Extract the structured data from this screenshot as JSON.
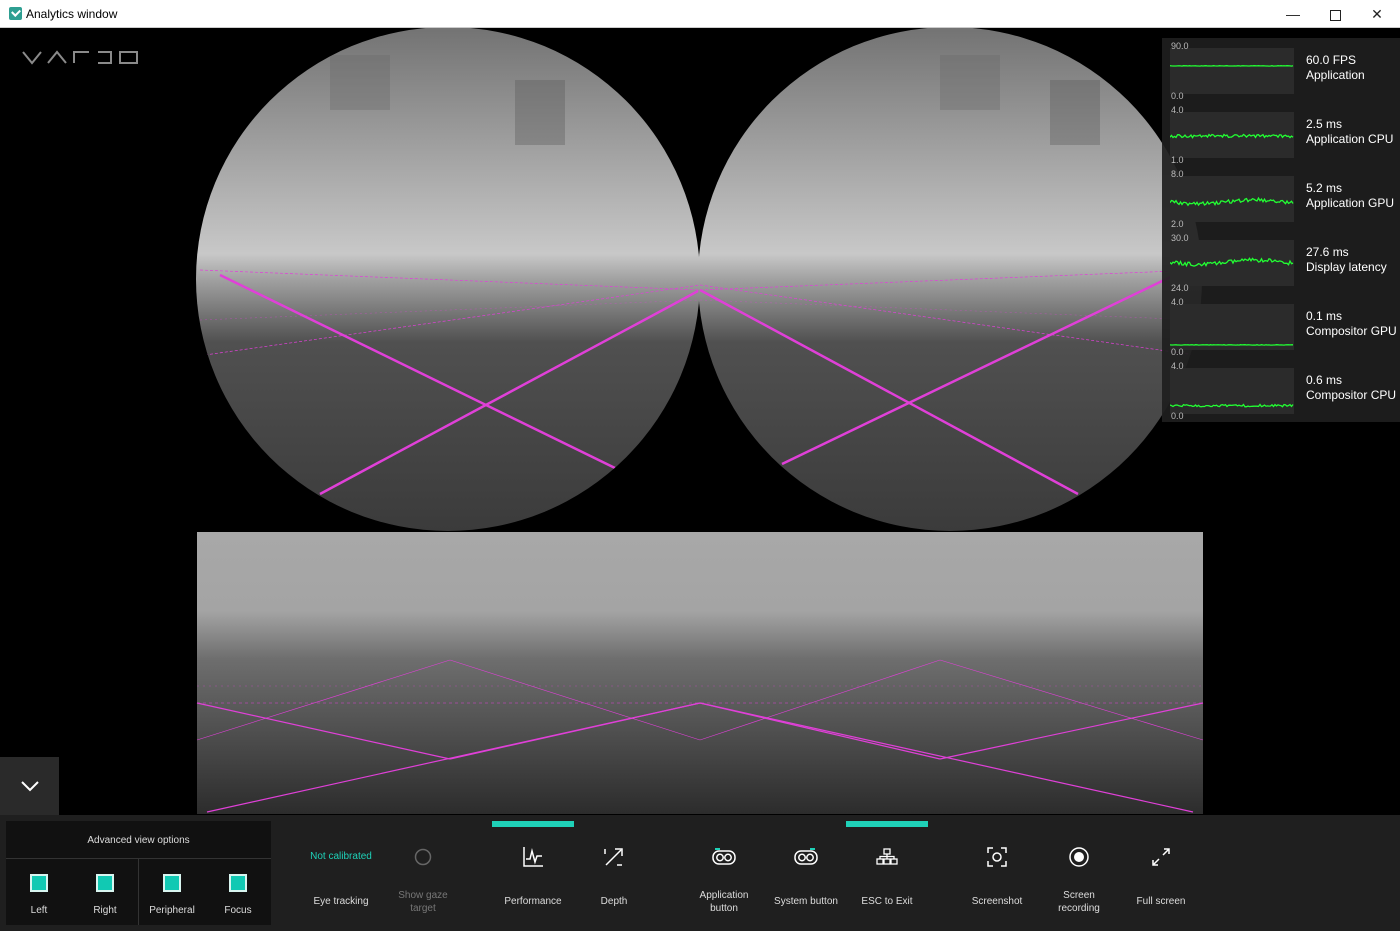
{
  "window": {
    "title": "Analytics window",
    "minimize": "—",
    "close": "✕"
  },
  "colors": {
    "accent": "#1fd1b8",
    "grid": "#e040d8",
    "graph": "#22ff33",
    "panel": "#1f1f1f"
  },
  "performance": [
    {
      "max": "90.0",
      "min": "0.0",
      "value": "60.0 FPS",
      "label": "Application",
      "level": 0.67,
      "noise": 0.2
    },
    {
      "max": "4.0",
      "min": "1.0",
      "value": "2.5 ms",
      "label": "Application CPU",
      "level": 0.5,
      "noise": 1.6
    },
    {
      "max": "8.0",
      "min": "2.0",
      "value": "5.2 ms",
      "label": "Application GPU",
      "level": 0.45,
      "noise": 1.8
    },
    {
      "max": "30.0",
      "min": "24.0",
      "value": "27.6 ms",
      "label": "Display latency",
      "level": 0.55,
      "noise": 2.0
    },
    {
      "max": "4.0",
      "min": "0.0",
      "value": "0.1 ms",
      "label": "Compositor GPU",
      "level": 0.03,
      "noise": 0.2
    },
    {
      "max": "4.0",
      "min": "0.0",
      "value": "0.6 ms",
      "label": "Compositor CPU",
      "level": 0.12,
      "noise": 1.2
    }
  ],
  "advanced": {
    "title": "Advanced view options",
    "items": [
      "Left",
      "Right",
      "Peripheral",
      "Focus"
    ]
  },
  "toolbar": {
    "eye_tracking_status": "Not calibrated",
    "eye_tracking": "Eye tracking",
    "gaze_target_1": "Show gaze",
    "gaze_target_2": "target",
    "performance": "Performance",
    "depth": "Depth",
    "app_button_1": "Application",
    "app_button_2": "button",
    "system_button": "System button",
    "esc": "ESC to Exit",
    "screenshot": "Screenshot",
    "recording_1": "Screen",
    "recording_2": "recording",
    "fullscreen": "Full screen"
  }
}
